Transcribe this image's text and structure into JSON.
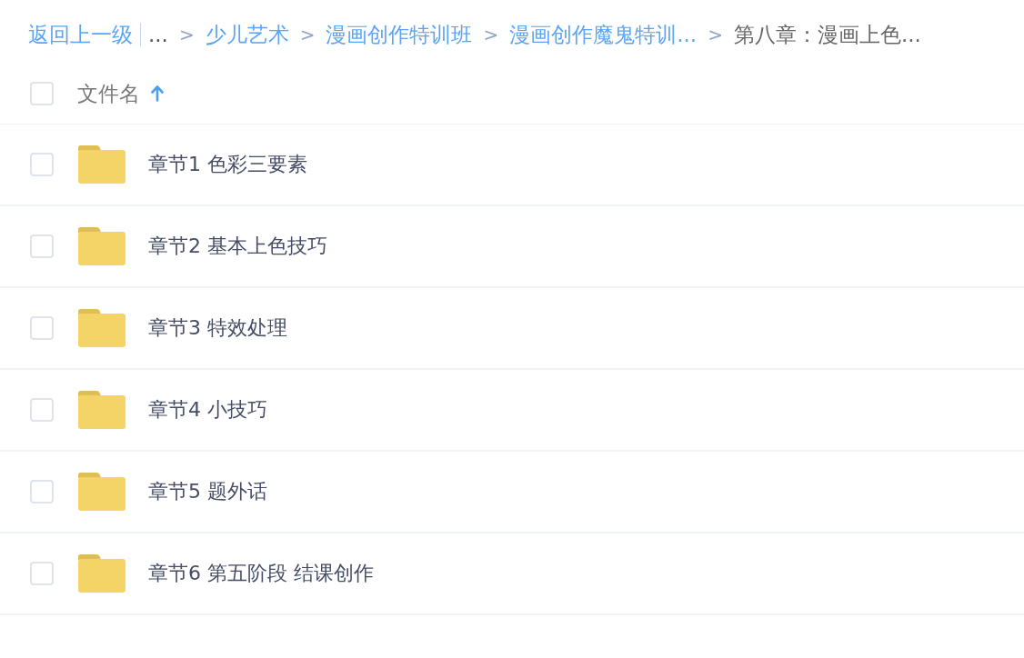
{
  "breadcrumb": {
    "back": "返回上一级",
    "items": [
      {
        "kind": "ellipsis",
        "label": "..."
      },
      {
        "kind": "link",
        "separator": ">",
        "label": "少儿艺术"
      },
      {
        "kind": "link",
        "separator": ">",
        "label": "漫画创作特训班"
      },
      {
        "kind": "link",
        "separator": ">",
        "label": "漫画创作魔鬼特训..."
      },
      {
        "kind": "current",
        "separator": ">",
        "label": "第八章：漫画上色..."
      }
    ]
  },
  "file_table": {
    "header": {
      "checked": false,
      "column": "文件名",
      "sort_ascending": true
    },
    "rows": [
      {
        "checked": false,
        "name": "章节1 色彩三要素"
      },
      {
        "checked": false,
        "name": "章节2 基本上色技巧"
      },
      {
        "checked": false,
        "name": "章节3 特效处理"
      },
      {
        "checked": false,
        "name": "章节4 小技巧"
      },
      {
        "checked": false,
        "name": "章节5 题外话"
      },
      {
        "checked": false,
        "name": "章节6 第五阶段 结课创作"
      }
    ]
  }
}
